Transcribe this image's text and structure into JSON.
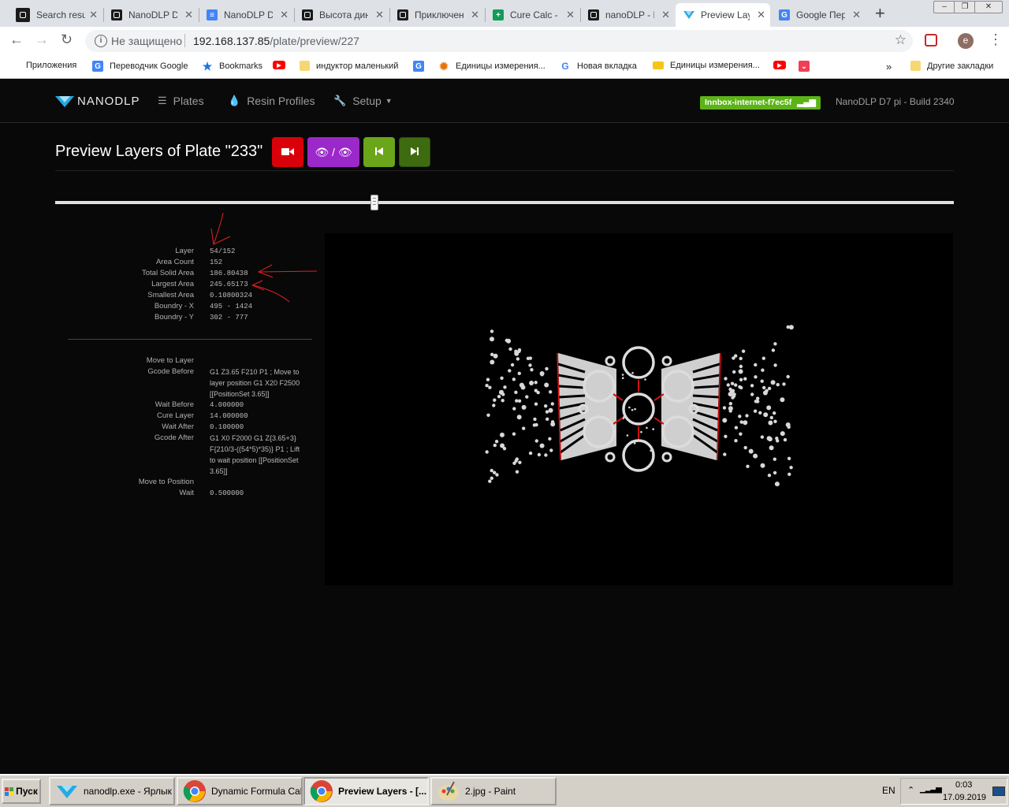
{
  "browser": {
    "tabs": [
      {
        "title": "Search resu",
        "icon": "nanodlp-icon",
        "color": "#1a1a1a"
      },
      {
        "title": "NanoDLP Dy",
        "icon": "nanodlp-icon",
        "color": "#1a1a1a"
      },
      {
        "title": "NanoDLP Dy",
        "icon": "docs-icon",
        "color": "#4285f4"
      },
      {
        "title": "Высота дин",
        "icon": "nanodlp-icon",
        "color": "#1a1a1a"
      },
      {
        "title": "Приключен",
        "icon": "nanodlp-icon",
        "color": "#1a1a1a"
      },
      {
        "title": "Cure Calc -",
        "icon": "sheets-icon",
        "color": "#0f9d58"
      },
      {
        "title": "nanoDLP - D",
        "icon": "nanodlp-icon",
        "color": "#1a1a1a"
      },
      {
        "title": "Preview Lay",
        "icon": "nanodlp-logo-icon",
        "color": "#27a9e1",
        "active": true
      },
      {
        "title": "Google Пер",
        "icon": "translate-icon",
        "color": "#4285f4"
      }
    ],
    "address": {
      "insecure_label": "Не защищено",
      "host": "192.168.137.85",
      "path": "/plate/preview/227"
    },
    "bookmarks": [
      {
        "label": "Приложения",
        "icon": "apps-icon"
      },
      {
        "label": "Переводчик Google",
        "icon": "translate-icon"
      },
      {
        "label": "Bookmarks",
        "icon": "star-icon"
      },
      {
        "label": "",
        "icon": "youtube-icon"
      },
      {
        "label": "индуктор маленький",
        "icon": "folder-icon"
      },
      {
        "label": "",
        "icon": "translate-icon"
      },
      {
        "label": "Единицы измерения...",
        "icon": "gear-icon"
      },
      {
        "label": "Новая вкладка",
        "icon": "google-icon"
      },
      {
        "label": "Единицы измерения...",
        "icon": "ruler-icon"
      },
      {
        "label": "",
        "icon": "youtube-icon"
      },
      {
        "label": "",
        "icon": "pocket-icon"
      }
    ],
    "more_bookmarks": "»",
    "other_bookmarks": "Другие закладки",
    "profile_letter": "e"
  },
  "app": {
    "brand": "NANODLP",
    "nav": [
      {
        "label": "Plates",
        "icon": "list-icon"
      },
      {
        "label": "Resin Profiles",
        "icon": "drop-icon"
      },
      {
        "label": "Setup",
        "icon": "wrench-icon",
        "caret": true
      }
    ],
    "wifi": "Innbox-internet-f7ec5f",
    "build": "NanoDLP D7 pi - Build 2340",
    "page_title": "Preview Layers of Plate \"233\"",
    "buttons": [
      {
        "name": "record-button",
        "icon": "camera-icon",
        "color": "#d9000a"
      },
      {
        "name": "visibility-toggle-button",
        "icon": "eye-icon",
        "color": "#9b28c9"
      },
      {
        "name": "first-layer-button",
        "icon": "step-backward-icon",
        "color": "#6aa51a"
      },
      {
        "name": "next-layer-button",
        "icon": "step-forward-icon",
        "color": "#3f6b10"
      }
    ],
    "slider_value": 0.355
  },
  "layer_info": {
    "stats": [
      {
        "label": "Layer",
        "value": "54/152"
      },
      {
        "label": "Area Count",
        "value": "152"
      },
      {
        "label": "Total Solid Area",
        "value": "186.80438"
      },
      {
        "label": "Largest Area",
        "value": "245.65173"
      },
      {
        "label": "Smallest Area",
        "value": "0.10800324"
      },
      {
        "label": "Boundry - X",
        "value": "495 - 1424"
      },
      {
        "label": "Boundry - Y",
        "value": "302 - 777"
      }
    ],
    "gcode": {
      "move_to_layer": {
        "label": "Move to Layer",
        "value": ""
      },
      "gcode_before": {
        "label": "Gcode Before",
        "lines": [
          "G1 Z3.65 F210 P1 ; Move to",
          "layer position G1 X20 F2500",
          "[[PositionSet 3.65]]"
        ]
      },
      "wait_before": {
        "label": "Wait Before",
        "value": "4.000000"
      },
      "cure_layer": {
        "label": "Cure Layer",
        "value": "14.000000"
      },
      "wait_after": {
        "label": "Wait After",
        "value": "0.100000"
      },
      "gcode_after": {
        "label": "Gcode After",
        "lines": [
          "G1 X0 F2000 G1 Z{3.65+3}",
          "F{210/3-((54*5)*35)} P1 ; Lift",
          "to wait position [[PositionSet",
          "3.65]]"
        ]
      },
      "move_to_position": {
        "label": "Move to Position",
        "value": ""
      },
      "wait": {
        "label": "Wait",
        "value": "0.500000"
      }
    }
  },
  "taskbar": {
    "start": "Пуск",
    "tasks": [
      {
        "label": "nanodlp.exe - Ярлык",
        "icon": "nanodlp-logo-icon"
      },
      {
        "label": "Dynamic Formula Calc...",
        "icon": "chrome-icon"
      },
      {
        "label": "Preview Layers - [...",
        "icon": "chrome-icon",
        "active": true
      },
      {
        "label": "2.jpg - Paint",
        "icon": "paint-icon"
      }
    ],
    "lang": "EN",
    "time": "0:03",
    "date": "17.09.2019"
  }
}
